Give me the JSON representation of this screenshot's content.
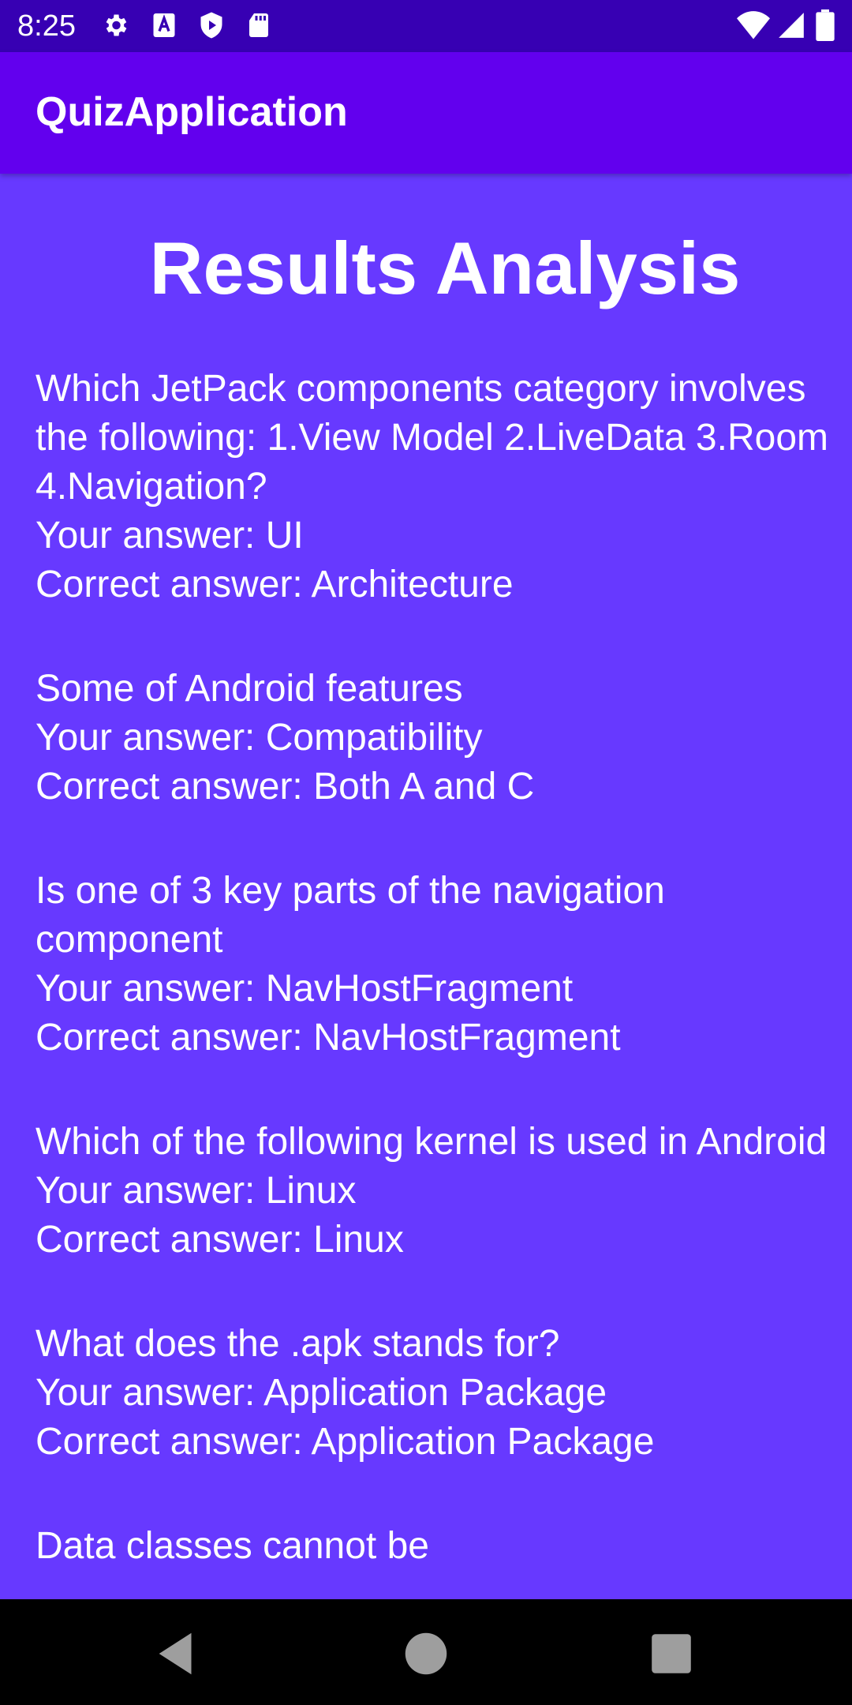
{
  "status_bar": {
    "time": "8:25",
    "left_icons": [
      "settings-icon",
      "text-a-icon",
      "play-protect-icon",
      "sd-card-icon"
    ],
    "right_icons": [
      "wifi-icon",
      "cell-signal-icon",
      "battery-icon"
    ]
  },
  "app_bar": {
    "title": "QuizApplication",
    "color": "#6200ee"
  },
  "content": {
    "heading": "Results Analysis",
    "background": "#6739ff",
    "results": [
      {
        "question": "Which JetPack components category involves the following: 1.View Model 2.LiveData 3.Room 4.Navigation?",
        "your_answer": "Your answer: UI",
        "correct_answer": "Correct answer: Architecture"
      },
      {
        "question": "Some of Android features",
        "your_answer": "Your answer: Compatibility",
        "correct_answer": "Correct answer: Both A and C"
      },
      {
        "question": "Is one of 3 key parts of the navigation component",
        "your_answer": "Your answer: NavHostFragment",
        "correct_answer": "Correct answer: NavHostFragment"
      },
      {
        "question": "Which of the following kernel is used in Android",
        "your_answer": "Your answer: Linux",
        "correct_answer": "Correct answer: Linux"
      },
      {
        "question": "What does the .apk stands for?",
        "your_answer": "Your answer: Application Package",
        "correct_answer": "Correct answer: Application Package"
      },
      {
        "question": "Data classes cannot be",
        "your_answer": "",
        "correct_answer": ""
      }
    ]
  },
  "nav_bar": {
    "buttons": [
      "back-icon",
      "home-icon",
      "recents-icon"
    ]
  }
}
